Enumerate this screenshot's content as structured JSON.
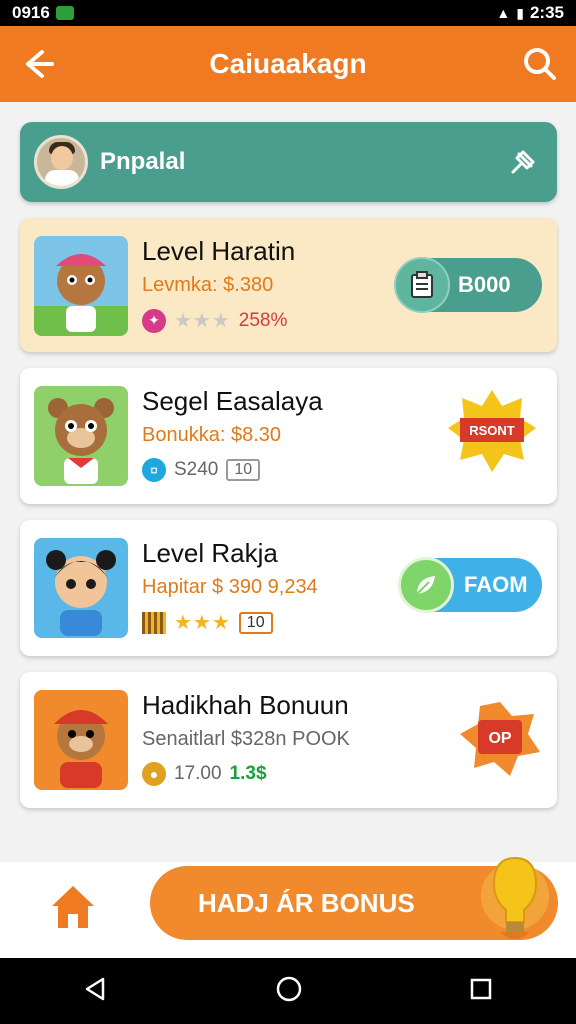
{
  "status_bar": {
    "time_left": "0916",
    "time_right": "2:35",
    "signal_icon": "signal-icon",
    "battery_icon": "battery-icon"
  },
  "app_bar": {
    "title": "Caiuaakagn",
    "back_icon": "back-arrow-icon",
    "search_icon": "search-icon"
  },
  "popular": {
    "label": "Pnpalal",
    "pin_icon": "pin-icon"
  },
  "cards": [
    {
      "name": "Level Haratin",
      "subtitle": "Levmka: $.380",
      "meta_value": "258%",
      "button_label": "B000",
      "stars": 3
    },
    {
      "name": "Segel Easalaya",
      "subtitle": "Bonukka: $8.30",
      "meta_value": "S240",
      "box": "10",
      "badge_label": "RSONT"
    },
    {
      "name": "Level Rakja",
      "subtitle": "Hapitar $ 390 9,234",
      "box": "10",
      "button_label": "FAOM",
      "stars": 3
    },
    {
      "name": "Hadikhah Bonuun",
      "subtitle": "Senaitlarl $328n POOK",
      "meta_value": "17.00",
      "meta_value2": "1.3$",
      "badge_label": "OP"
    }
  ],
  "bottom": {
    "home_icon": "home-icon",
    "bonus_label": "HADJ ÁR BONUS",
    "bulb_icon": "lightbulb-icon"
  },
  "colors": {
    "primary": "#f07a22",
    "teal": "#4a9e8e",
    "featured_bg": "#fbe8c4"
  }
}
